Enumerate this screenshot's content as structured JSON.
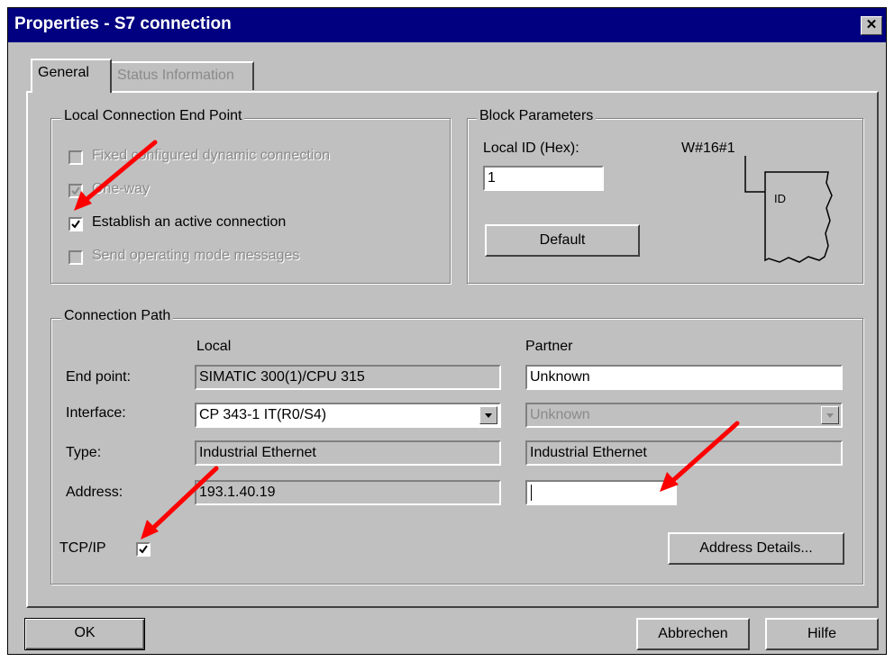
{
  "window": {
    "title": "Properties - S7 connection",
    "close_glyph": "✕"
  },
  "tabs": [
    {
      "label": "General",
      "active": true
    },
    {
      "label": "Status Information",
      "active": false
    }
  ],
  "local_end_point": {
    "legend": "Local Connection End Point",
    "options": [
      {
        "label": "Fixed configured dynamic connection",
        "checked": false,
        "enabled": false
      },
      {
        "label": "One-way",
        "checked": true,
        "enabled": false
      },
      {
        "label": "Establish an active connection",
        "checked": true,
        "enabled": true
      },
      {
        "label": "Send operating mode messages",
        "checked": false,
        "enabled": false
      }
    ]
  },
  "block_parameters": {
    "legend": "Block Parameters",
    "local_id_label": "Local ID (Hex):",
    "local_id_value": "1",
    "default_button": "Default",
    "diagram_label": "W#16#1",
    "diagram_id": "ID"
  },
  "connection_path": {
    "legend": "Connection Path",
    "local_header": "Local",
    "partner_header": "Partner",
    "rows": {
      "end_point": {
        "label": "End point:",
        "local": "SIMATIC 300(1)/CPU 315",
        "partner": "Unknown"
      },
      "interface": {
        "label": "Interface:",
        "local": "CP 343-1 IT(R0/S4)",
        "partner": "Unknown"
      },
      "type": {
        "label": "Type:",
        "local": "Industrial Ethernet",
        "partner": "Industrial Ethernet"
      },
      "address": {
        "label": "Address:",
        "local": "193.1.40.19",
        "partner": ""
      }
    },
    "tcpip_label": "TCP/IP",
    "tcpip_checked": true,
    "address_details_button": "Address Details..."
  },
  "footer": {
    "ok": "OK",
    "cancel": "Abbrechen",
    "help": "Hilfe"
  },
  "colors": {
    "title_bar": "#000080",
    "dialog_bg": "#c0c0c0",
    "annotation_arrow": "#ff0000"
  }
}
